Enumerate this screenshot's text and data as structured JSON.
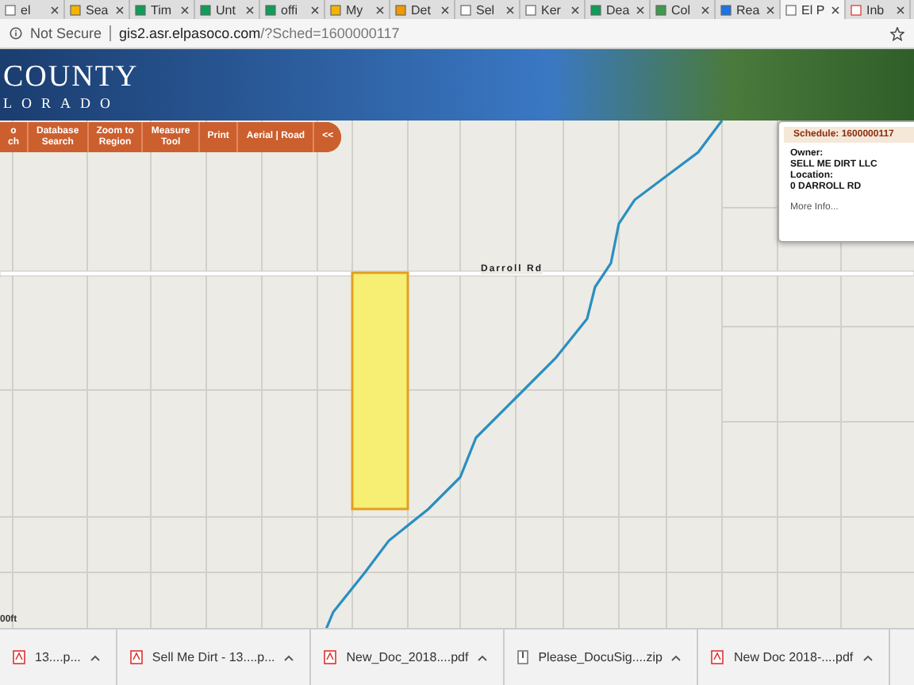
{
  "browser": {
    "tabs": [
      {
        "label": "el",
        "kind": "page",
        "selected": false
      },
      {
        "label": "Sea",
        "kind": "drive",
        "selected": false
      },
      {
        "label": "Tim",
        "kind": "sheet",
        "selected": false
      },
      {
        "label": "Unt",
        "kind": "sheet",
        "selected": false
      },
      {
        "label": "offi",
        "kind": "sheet",
        "selected": false
      },
      {
        "label": "My",
        "kind": "drive",
        "selected": false
      },
      {
        "label": "Det",
        "kind": "download",
        "selected": false
      },
      {
        "label": "Sel",
        "kind": "page",
        "selected": false
      },
      {
        "label": "Ker",
        "kind": "page",
        "selected": false
      },
      {
        "label": "Dea",
        "kind": "sheet",
        "selected": false
      },
      {
        "label": "Col",
        "kind": "form",
        "selected": false
      },
      {
        "label": "Rea",
        "kind": "edit",
        "selected": false
      },
      {
        "label": "El P",
        "kind": "page",
        "selected": true
      },
      {
        "label": "Inb",
        "kind": "mail",
        "selected": false
      }
    ],
    "security": "Not Secure",
    "url_host": "gis2.asr.elpasoco.com",
    "url_path": "/?Sched=1600000117"
  },
  "banner": {
    "title": "COUNTY",
    "subtitle": "LORADO"
  },
  "toolbar": [
    {
      "lines": [
        "o",
        "ch"
      ]
    },
    {
      "lines": [
        "Database",
        "Search"
      ]
    },
    {
      "lines": [
        "Zoom to",
        "Region"
      ]
    },
    {
      "lines": [
        "Measure",
        "Tool"
      ]
    },
    {
      "lines": [
        "Print"
      ]
    },
    {
      "lines": [
        "Aerial | Road"
      ]
    },
    {
      "lines": [
        "<<"
      ]
    }
  ],
  "map": {
    "road_label": "Darroll Rd",
    "scale_label": "00ft"
  },
  "popup": {
    "header": "Schedule: 1600000117",
    "owner_label": "Owner:",
    "owner": "SELL ME DIRT LLC",
    "location_label": "Location:",
    "location": "0 DARROLL RD",
    "link": "More Info..."
  },
  "downloads": [
    {
      "name": "13....p...",
      "kind": "pdf"
    },
    {
      "name": "Sell Me Dirt - 13....p...",
      "kind": "pdf"
    },
    {
      "name": "New_Doc_2018....pdf",
      "kind": "pdf"
    },
    {
      "name": "Please_DocuSig....zip",
      "kind": "zip"
    },
    {
      "name": "New Doc 2018-....pdf",
      "kind": "pdf"
    }
  ]
}
